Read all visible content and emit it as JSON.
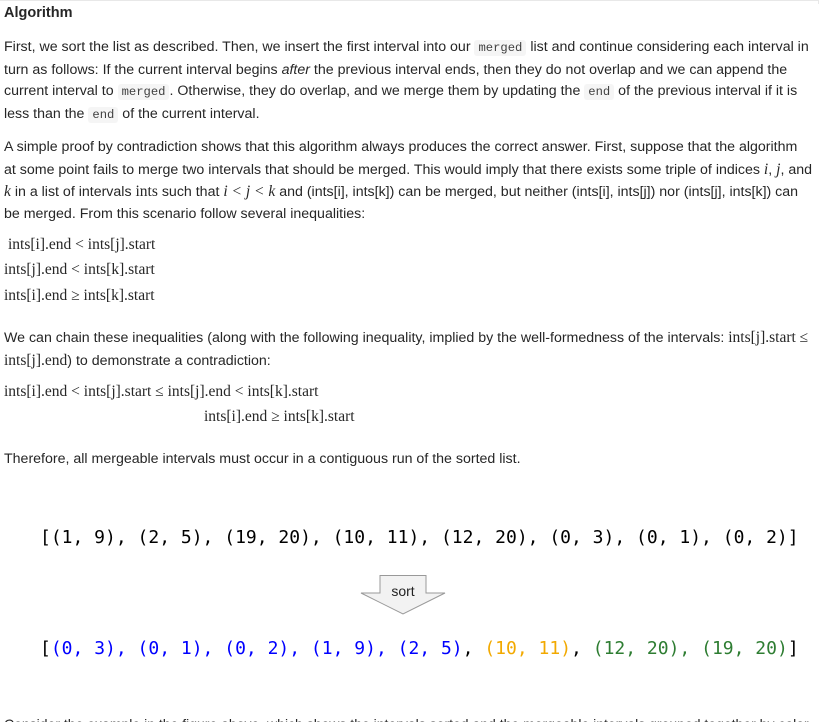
{
  "heading": "Algorithm",
  "p1": {
    "t1": "First, we sort the list as described. Then, we insert the first interval into our ",
    "c1": "merged",
    "t2": " list and continue considering each interval in turn as follows: If the current interval begins ",
    "em": "after",
    "t3": " the previous interval ends, then they do not overlap and we can append the current interval to ",
    "c2": "merged",
    "t4": ". Otherwise, they do overlap, and we merge them by updating the ",
    "c3": "end",
    "t5": " of the previous interval if it is less than the ",
    "c4": "end",
    "t6": " of the current interval."
  },
  "p2": {
    "t1": "A simple proof by contradiction shows that this algorithm always produces the correct answer. First, suppose that the algorithm at some point fails to merge two intervals that should be merged. This would imply that there exists some triple of indices ",
    "i": "i",
    "s1": ", ",
    "j": "j",
    "s2": ", and ",
    "k": "k",
    "t2": " in a list of intervals ",
    "ints": "ints",
    "t3": " such that ",
    "ineq": "i < j < k",
    "t4": " and (ints[i], ints[k]) can be merged, but neither (ints[i], ints[j]) nor (ints[j], ints[k]) can be merged. From this scenario follow several inequalities:"
  },
  "eq1": [
    "ints[i].end < ints[j].start",
    "ints[j].end < ints[k].start",
    "ints[i].end ≥ ints[k].start"
  ],
  "p3": {
    "t1": "We can chain these inequalities (along with the following inequality, implied by the well-formedness of the intervals: ",
    "math": "ints[j].start ≤ ints[j].end",
    "t2": ") to demonstrate a contradiction:"
  },
  "eq2": [
    "ints[i].end < ints[j].start ≤ ints[j].end < ints[k].start",
    "ints[i].end ≥ ints[k].start"
  ],
  "p4": "Therefore, all mergeable intervals must occur in a contiguous run of the sorted list.",
  "figure": {
    "unsorted": "[(1, 9), (2, 5), (19, 20), (10, 11), (12, 20), (0, 3), (0, 1), (0, 2)]",
    "sort_label": "sort",
    "sorted_open": "[",
    "sorted_blue": "(0, 3), (0, 1), (0, 2), (1, 9), (2, 5)",
    "comma1": ", ",
    "sorted_orange": "(10, 11)",
    "comma2": ", ",
    "sorted_green": "(12, 20), (19, 20)",
    "sorted_close": "]",
    "colors": {
      "blue": "#0000ff",
      "orange": "#f2a900",
      "green": "#2e7d32",
      "black": "#000000"
    }
  },
  "bottom": "Consider the example in the figure above, which shows the intervals sorted and the mergeable intervals grouped together by color."
}
